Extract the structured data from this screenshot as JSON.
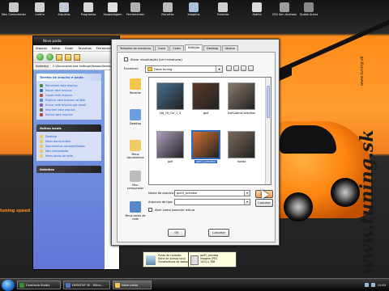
{
  "desktop": {
    "icons": [
      {
        "label": "Meu Computador",
        "color": "#c8c8c8"
      },
      {
        "label": "Lixeira",
        "color": "#d0d0d0"
      },
      {
        "label": "Arquivos",
        "color": "#c0c8d8"
      },
      {
        "label": "Programas",
        "color": "#d8d8d8"
      },
      {
        "label": "Hospedagem",
        "color": "#e0e0e0"
      },
      {
        "label": "Ferramentas",
        "color": "#b0b0b0"
      },
      {
        "label": "Recortes",
        "color": "#bbbbbb"
      },
      {
        "label": "Imagens",
        "color": "#a9c0d9"
      },
      {
        "label": "Tutoriais",
        "color": "#cfcfcf"
      },
      {
        "label": "Atalho",
        "color": "#dadada"
      },
      {
        "label": "GTA San Andreas",
        "color": "#9c9c9c"
      },
      {
        "label": "Quake Arena",
        "color": "#8a8a8a"
      }
    ],
    "left_text": "tuning speed",
    "brand_big": "www.tuning.sk",
    "brand_small": "www.tuning.sk"
  },
  "explorer": {
    "title": "Nova pasta",
    "menu": [
      "Arquivo",
      "Editar",
      "Exibir",
      "Favoritos",
      "Ferramentas",
      "Ajuda"
    ],
    "address_label": "Endereço",
    "address_value": "C:\\Documents and Settings\\Renato\\Desktop\\Nova pasta",
    "file_tasks": {
      "title": "Tarefas de arquivo e pasta",
      "items": [
        "Renomear este arquivo",
        "Mover este arquivo",
        "Copiar este arquivo",
        "Publicar este arquivo na Web",
        "Enviar este arquivo por email",
        "Imprimir este arquivo",
        "Excluir este arquivo"
      ]
    },
    "other_places": {
      "title": "Outros locais",
      "items": [
        "Desktop",
        "Meus documentos",
        "Documentos compartilhados",
        "Meu computador",
        "Meus locais de rede"
      ]
    },
    "details_title": "Detalhes"
  },
  "dialog": {
    "tabs": [
      "Tamanho da miniatura",
      "Ícone",
      "Cores",
      "Exibição",
      "Desktop",
      "Idioma"
    ],
    "active_tab": "Exibição",
    "preview_checkbox": "Ativar visualização (ver miniaturas)",
    "look_in_label": "Examinar:",
    "look_in_value": "Fotos tuning",
    "places": [
      {
        "label": "Recente",
        "color": "#f2c64a"
      },
      {
        "label": "Desktop",
        "color": "#6aa0e0"
      },
      {
        "label": "Meus documentos",
        "color": "#f0cc66"
      },
      {
        "label": "Meu computador",
        "color": "#bcbcbc"
      },
      {
        "label": "Meus locais de rede",
        "color": "#5588cc"
      }
    ],
    "thumbnails": [
      {
        "label": "Ltd_Of_Cor_1_3",
        "color": "#4a7090",
        "selected": false
      },
      {
        "label": "golf",
        "color": "#5a3a2a",
        "selected": false
      },
      {
        "label": "GolfCabrioCollection",
        "color": "#8a7a6a",
        "selected": false
      },
      {
        "label": "golf",
        "color": "#b0a0c0",
        "selected": false
      },
      {
        "label": "golf3_preview",
        "color": "#d07030",
        "selected": true
      },
      {
        "label": "honda",
        "color": "#7a6a5a",
        "selected": false
      }
    ],
    "file_name_label": "Nome do arquivo:",
    "file_name_value": "golf3_preview",
    "file_type_label": "Arquivos do tipo:",
    "file_type_value": "",
    "readonly_label": "Abrir como somente leitura",
    "open_button": "Abrir",
    "cancel_button": "Cancelar",
    "ok_button": "OK",
    "cancel2_button": "Cancelar"
  },
  "tooltips": [
    {
      "lines": [
        "Ponto de conexão",
        "Falha de acesso local",
        "Transferência de dados 100Mbps"
      ]
    },
    {
      "lines": [
        "golf3_preview",
        "Imagem JPEG",
        "1024 x 768"
      ]
    }
  ],
  "taskbar": {
    "tasks": [
      {
        "label": "Camtasia Studio",
        "color": "#3b8a3b"
      },
      {
        "label": "DESKTOP 50 - Micro...",
        "color": "#4a78c8"
      },
      {
        "label": "Nova pasta",
        "color": "#f0c850"
      }
    ],
    "active_task": "Nova pasta",
    "clock": "10:45"
  }
}
